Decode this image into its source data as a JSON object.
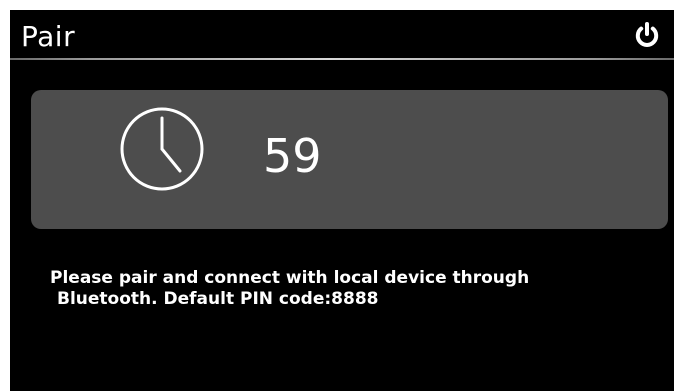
{
  "header": {
    "title": "Pair",
    "power_icon": "power-icon"
  },
  "timer": {
    "clock_icon": "clock-icon",
    "countdown": "59"
  },
  "message": {
    "line1": "Please pair and connect with local device through",
    "line2": "Bluetooth. Default PIN code:8888"
  },
  "colors": {
    "background": "#000000",
    "panel": "#4d4d4d",
    "text": "#ffffff",
    "frame": "#ffffff"
  }
}
